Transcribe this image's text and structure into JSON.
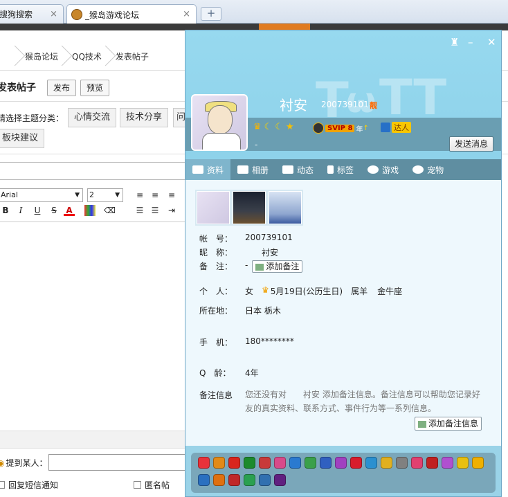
{
  "browser": {
    "tabs": [
      {
        "label": "搜狗搜索",
        "close": "×"
      },
      {
        "label": "_猴岛游戏论坛",
        "close": "×"
      }
    ],
    "new_tab": "+"
  },
  "forum": {
    "breadcrumb": [
      "猴岛论坛",
      "QQ技术",
      "发表帖子"
    ],
    "post_title": "发表帖子",
    "publish_label": "发布",
    "preview_label": "预览",
    "category_prompt": "请选择主题分类：",
    "categories": [
      "心情交流",
      "技术分享",
      "问",
      "板块建议"
    ],
    "font_family": "Arial",
    "font_size": "2",
    "mention_label": "提到某人：",
    "sms_notify_label": "回复短信通知",
    "anonymous_label": "匿名帖"
  },
  "profile": {
    "nickname": "衬安",
    "qq_number": "200739101",
    "vip_tag": "靓",
    "svip_label": "SVIP 8",
    "svip_year": "年",
    "daren_label": "达人",
    "signature": "-",
    "send_message_label": "发送消息",
    "tabs": [
      "资料",
      "相册",
      "动态",
      "标签",
      "游戏",
      "宠物"
    ],
    "fields": {
      "account_label": "帐　号：",
      "account": "200739101",
      "nick_label": "昵　称：",
      "nick": "衬安",
      "remark_label": "备　注：",
      "remark": "-",
      "add_remark_label": "添加备注",
      "personal_label": "个　人：",
      "gender": "女",
      "birthday": "5月19日(公历生日)",
      "zodiac": "属羊",
      "constellation": "金牛座",
      "location_label": "所在地：",
      "location": "日本 栃木",
      "phone_label": "手　机：",
      "phone": "180********",
      "qage_label": "Q　龄：",
      "qage": "4年",
      "note_label": "备注信息",
      "note_text": "您还没有对　　衬安 添加备注信息。备注信息可以帮助您记录好友的真实资料、联系方式、事件行为等一系列信息。",
      "add_note_info_label": "添加备注信息"
    },
    "service_icon_colors": [
      "#e8323a",
      "#e28a18",
      "#d9251d",
      "#1c8a2c",
      "#c83a3a",
      "#d84a8a",
      "#2a7ad0",
      "#3aa04a",
      "#3060c0",
      "#a040c0",
      "#d81c2c",
      "#2a90d0",
      "#e0b020",
      "#808080",
      "#e04070",
      "#c02020",
      "#b050d0",
      "#e8c010",
      "#f0b000",
      "#2a70c0",
      "#e07010",
      "#c02828",
      "#2aa050",
      "#3070b0",
      "#602080"
    ]
  }
}
